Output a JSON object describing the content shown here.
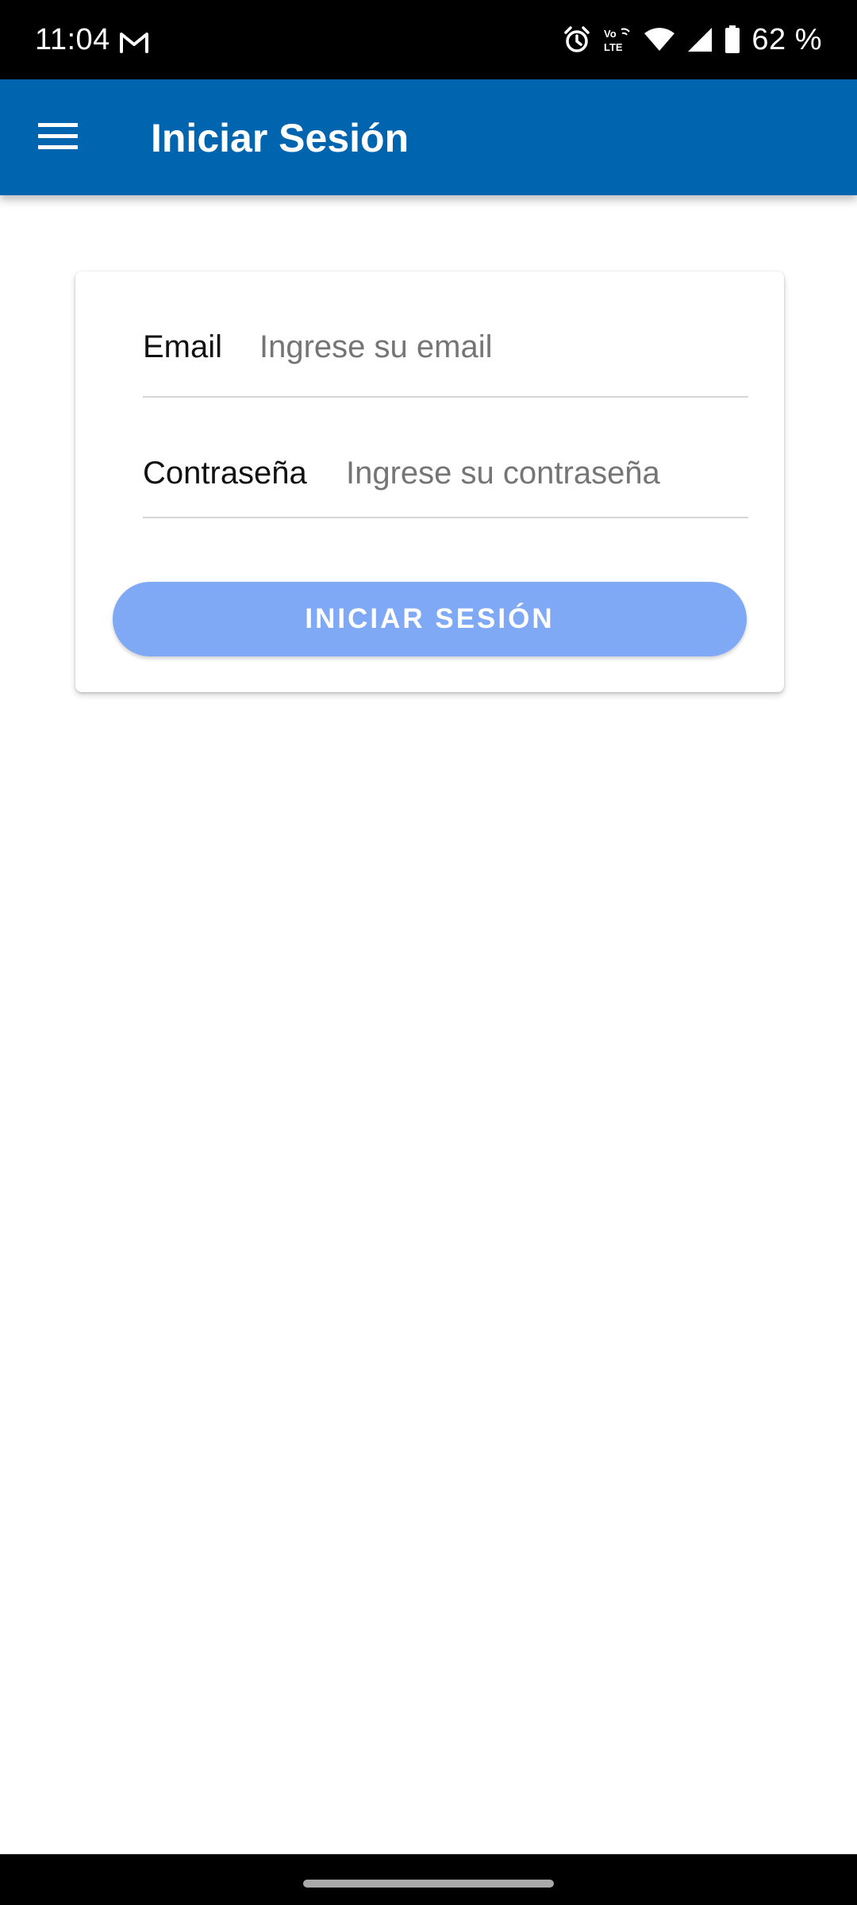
{
  "status_bar": {
    "time": "11:04",
    "notification_icon": "gmail-icon",
    "icons": [
      "alarm-icon",
      "volte-icon",
      "wifi-icon",
      "cell-signal-icon",
      "battery-icon"
    ],
    "volte_label": "Vo LTE",
    "battery": "62 %"
  },
  "app_bar": {
    "menu_icon": "menu-icon",
    "title": "Iniciar Sesión",
    "color": "#0064AF"
  },
  "form": {
    "email": {
      "label": "Email",
      "placeholder": "Ingrese su email",
      "value": ""
    },
    "password": {
      "label": "Contraseña",
      "placeholder": "Ingrese su contraseña",
      "value": ""
    },
    "submit_label": "INICIAR SESIÓN",
    "submit_color": "#80A9F5"
  }
}
